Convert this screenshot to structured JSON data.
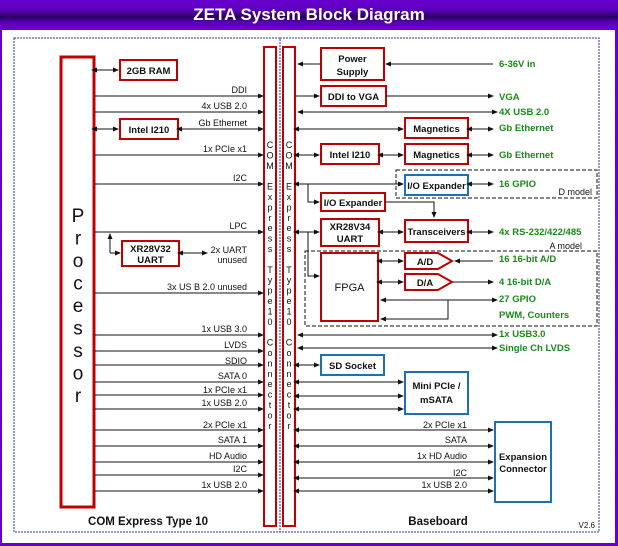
{
  "title": "ZETA System Block Diagram",
  "colors": {
    "frame": "#6600cc",
    "block_red": "#c00000",
    "block_blue": "#1f6fb5",
    "output_green": "#1a8a1a",
    "region_border": "#333399"
  },
  "sections": {
    "left": "COM Express Type 10",
    "right": "Baseboard",
    "version": "V2.6"
  },
  "processor": {
    "label": "Processor",
    "letters": [
      "P",
      "r",
      "o",
      "c",
      "e",
      "s",
      "s",
      "o",
      "r"
    ]
  },
  "connector": {
    "letters": [
      "C",
      "O",
      "M",
      "",
      "E",
      "x",
      "p",
      "r",
      "e",
      "s",
      "s",
      "",
      "T",
      "y",
      "p",
      "e",
      "1",
      "0",
      "",
      "C",
      "o",
      "n",
      "n",
      "e",
      "c",
      "t",
      "o",
      "r"
    ]
  },
  "left_blocks": {
    "ram": "2GB RAM",
    "intel": "Intel I210",
    "uart_line1": "XR28V32",
    "uart_line2": "UART"
  },
  "left_signals": {
    "ddi": "DDI",
    "usb4": "4x USB 2.0",
    "gbe": "Gb Ethernet",
    "pcie1": "1x PCIe x1",
    "i2c": "I2C",
    "lpc": "LPC",
    "uart_unused_1": "2x UART",
    "uart_unused_2": "unused",
    "usb_unused": "3x US B 2.0 unused",
    "usb3": "1x USB 3.0",
    "lvds": "LVDS",
    "sdio": "SDIO",
    "sata0": "SATA 0",
    "pcie1b": "1x PCIe x1",
    "usb2": "1x USB 2.0",
    "pcie2": "2x PCIe x1",
    "sata1": "SATA 1",
    "hda": "HD Audio",
    "i2c2": "I2C",
    "usb2b": "1x USB 2.0"
  },
  "right_blocks": {
    "power_1": "Power",
    "power_2": "Supply",
    "ddi_vga": "DDI to VGA",
    "magnetics1": "Magnetics",
    "intel": "Intel I210",
    "magnetics2": "Magnetics",
    "io_exp_blue": "I/O Expander",
    "io_exp": "I/O Expander",
    "uart_1": "XR28V34",
    "uart_2": "UART",
    "transceivers": "Transceivers",
    "fpga": "FPGA",
    "ad": "A/D",
    "da": "D/A",
    "sd": "SD Socket",
    "minipcie_1": "Mini PCIe /",
    "minipcie_2": "mSATA",
    "exp_1": "Expansion",
    "exp_2": "Connector"
  },
  "model_labels": {
    "d": "D model",
    "a": "A model"
  },
  "outputs": {
    "power_in": "6-36V in",
    "vga": "VGA",
    "usb4": "4X USB 2.0",
    "gbe1": "Gb Ethernet",
    "gbe2": "Gb Ethernet",
    "gpio16": "16 GPIO",
    "rs": "4x RS-232/422/485",
    "ad": "16 16-bit A/D",
    "da": "4 16-bit D/A",
    "gpio27": "27 GPIO",
    "pwm": "PWM, Counters",
    "usb3": "1x USB3.0",
    "lvds": "Single Ch LVDS"
  },
  "exp_signals": {
    "pcie2": "2x PCIe x1",
    "sata": "SATA",
    "hda": "1x HD Audio",
    "i2c": "I2C",
    "usb2": "1x USB 2.0"
  }
}
